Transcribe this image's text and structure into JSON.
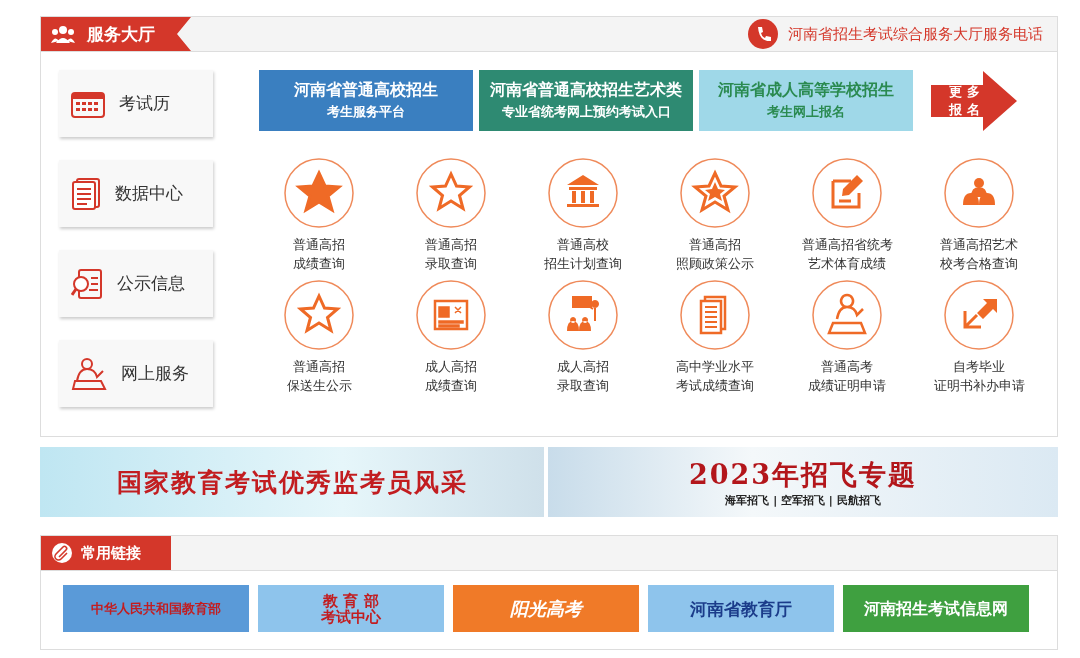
{
  "service_hall": {
    "title": "服务大厅",
    "hotline": "河南省招生考试综合服务大厅服务电话",
    "sidebar": [
      {
        "label": "考试历"
      },
      {
        "label": "数据中心"
      },
      {
        "label": "公示信息"
      },
      {
        "label": "网上服务"
      }
    ],
    "banners": [
      {
        "line1": "河南省普通高校招生",
        "line2": "考生服务平台"
      },
      {
        "line1": "河南省普通高校招生艺术类",
        "line2": "专业省统考网上预约考试入口"
      },
      {
        "line1": "河南省成人高等学校招生",
        "line2": "考生网上报名"
      }
    ],
    "more": {
      "top": "更",
      "top2": "多",
      "bottom": "报",
      "bottom2": "名"
    },
    "services": [
      {
        "line1": "普通高招",
        "line2": "成绩查询"
      },
      {
        "line1": "普通高招",
        "line2": "录取查询"
      },
      {
        "line1": "普通高校",
        "line2": "招生计划查询"
      },
      {
        "line1": "普通高招",
        "line2": "照顾政策公示"
      },
      {
        "line1": "普通高招省统考",
        "line2": "艺术体育成绩"
      },
      {
        "line1": "普通高招艺术",
        "line2": "校考合格查询"
      },
      {
        "line1": "普通高招",
        "line2": "保送生公示"
      },
      {
        "line1": "成人高招",
        "line2": "成绩查询"
      },
      {
        "line1": "成人高招",
        "line2": "录取查询"
      },
      {
        "line1": "高中学业水平",
        "line2": "考试成绩查询"
      },
      {
        "line1": "普通高考",
        "line2": "成绩证明申请"
      },
      {
        "line1": "自考毕业",
        "line2": "证明书补办申请"
      }
    ]
  },
  "promos": [
    {
      "title": "国家教育考试优秀监考员风采"
    },
    {
      "title": "2023年招飞专题",
      "subtitle": "海军招飞 | 空军招飞 | 民航招飞"
    }
  ],
  "links": {
    "title": "常用链接",
    "items": [
      {
        "lines": [
          "中华人民共和国教育部"
        ]
      },
      {
        "lines": [
          "教 育 部",
          "考试中心"
        ]
      },
      {
        "lines": [
          "阳光高考"
        ]
      },
      {
        "lines": [
          "河南省教育厅"
        ]
      },
      {
        "lines": [
          "河南招生考试信息网"
        ]
      }
    ]
  }
}
